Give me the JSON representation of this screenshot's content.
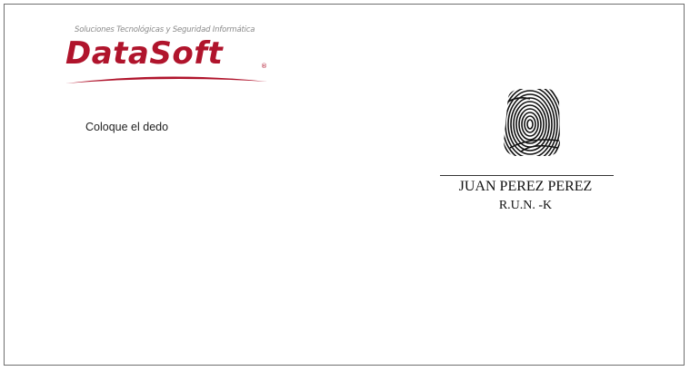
{
  "logo": {
    "tagline": "Soluciones Tecnológicas y Seguridad Informática",
    "brand": "DataSoft",
    "registered_mark": "®",
    "brand_color": "#b0142c",
    "tagline_color": "#8a8a8a"
  },
  "instruction": {
    "text": "Coloque el dedo"
  },
  "fingerprint": {
    "icon": "fingerprint-icon"
  },
  "signer": {
    "name": "JUAN PEREZ PEREZ",
    "run": "R.U.N. -K"
  }
}
